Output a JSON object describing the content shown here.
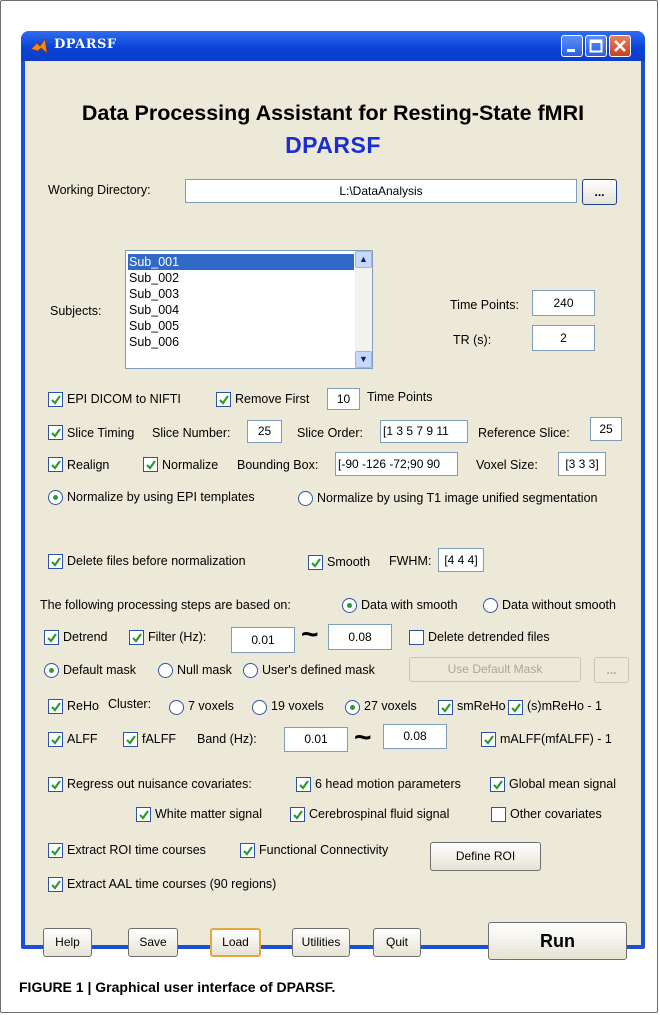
{
  "window": {
    "title": "DPARSF"
  },
  "header": {
    "title": "Data Processing Assistant for Resting-State fMRI",
    "subtitle": "DPARSF"
  },
  "working_directory": {
    "label": "Working Directory:",
    "value": "L:\\DataAnalysis",
    "browse_label": "..."
  },
  "subjects": {
    "label": "Subjects:",
    "items": [
      "Sub_001",
      "Sub_002",
      "Sub_003",
      "Sub_004",
      "Sub_005",
      "Sub_006"
    ],
    "selected": "Sub_001"
  },
  "time_points": {
    "label": "Time Points:",
    "value": "240"
  },
  "tr": {
    "label": "TR (s):",
    "value": "2"
  },
  "row_epi": {
    "epi_dicom": "EPI DICOM to NIFTI",
    "remove_first": "Remove First",
    "remove_value": "10",
    "time_points": "Time Points"
  },
  "row_slice": {
    "slice_timing": "Slice Timing",
    "slice_number_label": "Slice Number:",
    "slice_number": "25",
    "slice_order_label": "Slice Order:",
    "slice_order": "[1 3 5 7 9 11",
    "reference_label": "Reference Slice:",
    "reference": "25"
  },
  "row_realign": {
    "realign": "Realign",
    "normalize": "Normalize",
    "bbox_label": "Bounding Box:",
    "bbox": "[-90 -126 -72;90 90",
    "voxel_label": "Voxel Size:",
    "voxel": "[3 3 3]"
  },
  "row_norm_method": {
    "epi": "Normalize by using EPI templates",
    "t1": "Normalize by using T1 image unified segmentation"
  },
  "row_delete": {
    "delete_files": "Delete files before normalization",
    "smooth": "Smooth",
    "fwhm_label": "FWHM:",
    "fwhm": "[4 4 4]"
  },
  "row_basis": {
    "text": "The following processing steps are based on:",
    "with_smooth": "Data with smooth",
    "without_smooth": "Data without smooth"
  },
  "row_detrend": {
    "detrend": "Detrend",
    "filter": "Filter (Hz):",
    "low": "0.01",
    "high": "0.08",
    "delete_detrended": "Delete detrended files",
    "tilde": "~"
  },
  "row_mask": {
    "default": "Default mask",
    "null": "Null mask",
    "user": "User's defined mask",
    "use_default_button": "Use Default Mask",
    "browse": "..."
  },
  "row_reho": {
    "reho": "ReHo",
    "cluster_label": "Cluster:",
    "v7": "7 voxels",
    "v19": "19 voxels",
    "v27": "27 voxels",
    "smreho": "smReHo",
    "smreho1": "(s)mReHo - 1"
  },
  "row_alff": {
    "alff": "ALFF",
    "falff": "fALFF",
    "band_label": "Band (Hz):",
    "low": "0.01",
    "high": "0.08",
    "malff": "mALFF(mfALFF) - 1",
    "tilde": "~"
  },
  "row_regress": {
    "regress": "Regress out nuisance covariates:",
    "head_motion": "6 head motion parameters",
    "global_mean": "Global mean signal",
    "white_matter": "White matter signal",
    "csf": "Cerebrospinal fluid signal",
    "other": "Other covariates"
  },
  "row_roi": {
    "extract_roi": "Extract ROI time courses",
    "fc": "Functional Connectivity",
    "define_roi": "Define ROI",
    "extract_aal": "Extract AAL time courses (90 regions)"
  },
  "buttons": {
    "help": "Help",
    "save": "Save",
    "load": "Load",
    "utilities": "Utilities",
    "quit": "Quit",
    "run": "Run"
  },
  "caption": "FIGURE 1 | Graphical user interface of DPARSF.",
  "colors": {
    "titlebar": "#0a43d9",
    "client": "#ece9d8",
    "subtitle": "#1a2fcf",
    "selection": "#316ac5",
    "check": "#2e9a33"
  }
}
